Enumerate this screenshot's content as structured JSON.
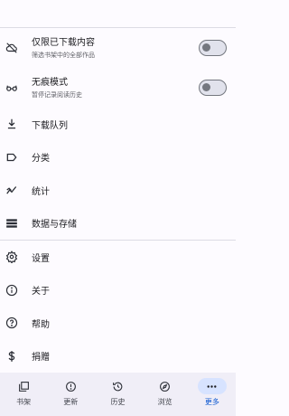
{
  "settings": {
    "downloaded_only": {
      "title": "仅限已下载内容",
      "subtitle": "筛选书架中的全部作品",
      "enabled": false
    },
    "incognito": {
      "title": "无痕模式",
      "subtitle": "暂停记录阅读历史",
      "enabled": false
    }
  },
  "menu": {
    "download_queue": "下载队列",
    "categories": "分类",
    "stats": "统计",
    "data_storage": "数据与存储",
    "settings": "设置",
    "about": "关于",
    "help": "帮助",
    "donate": "捐赠"
  },
  "bottom_nav": {
    "library": "书架",
    "updates": "更新",
    "history": "历史",
    "browse": "浏览",
    "more": "更多",
    "active": "more"
  },
  "colors": {
    "accent": "#0b57d0",
    "nav_active_bg": "#d7e3ff",
    "nav_bg": "#f0eef7"
  }
}
